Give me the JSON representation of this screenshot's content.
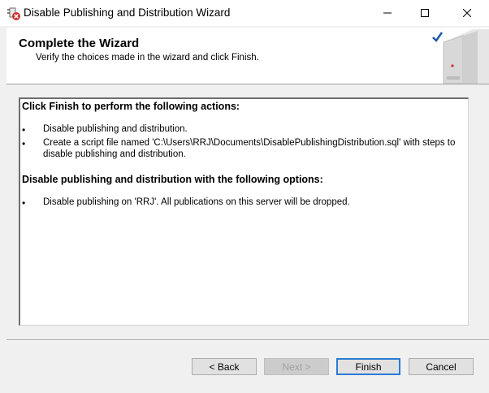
{
  "window": {
    "title": "Disable Publishing and Distribution Wizard",
    "controls": {
      "minimize": "—",
      "maximize": "☐",
      "close": "✕"
    }
  },
  "header": {
    "title": "Complete the Wizard",
    "subtitle": "Verify the choices made in the wizard and click Finish."
  },
  "content": {
    "section1": {
      "heading": "Click Finish to perform the following actions:",
      "items": [
        "Disable publishing and distribution.",
        "Create a script file named 'C:\\Users\\RRJ\\Documents\\DisablePublishingDistribution.sql' with steps to disable publishing and distribution."
      ]
    },
    "section2": {
      "heading": "Disable publishing and distribution with the following options:",
      "items": [
        "Disable publishing on 'RRJ'. All publications on this server will be dropped."
      ]
    },
    "bullet": "•"
  },
  "buttons": {
    "back": "< Back",
    "next": "Next >",
    "finish": "Finish",
    "cancel": "Cancel"
  },
  "colors": {
    "accent": "#2a7bd4",
    "checkmark": "#1e5aa8",
    "app_icon_red": "#d0312d"
  }
}
